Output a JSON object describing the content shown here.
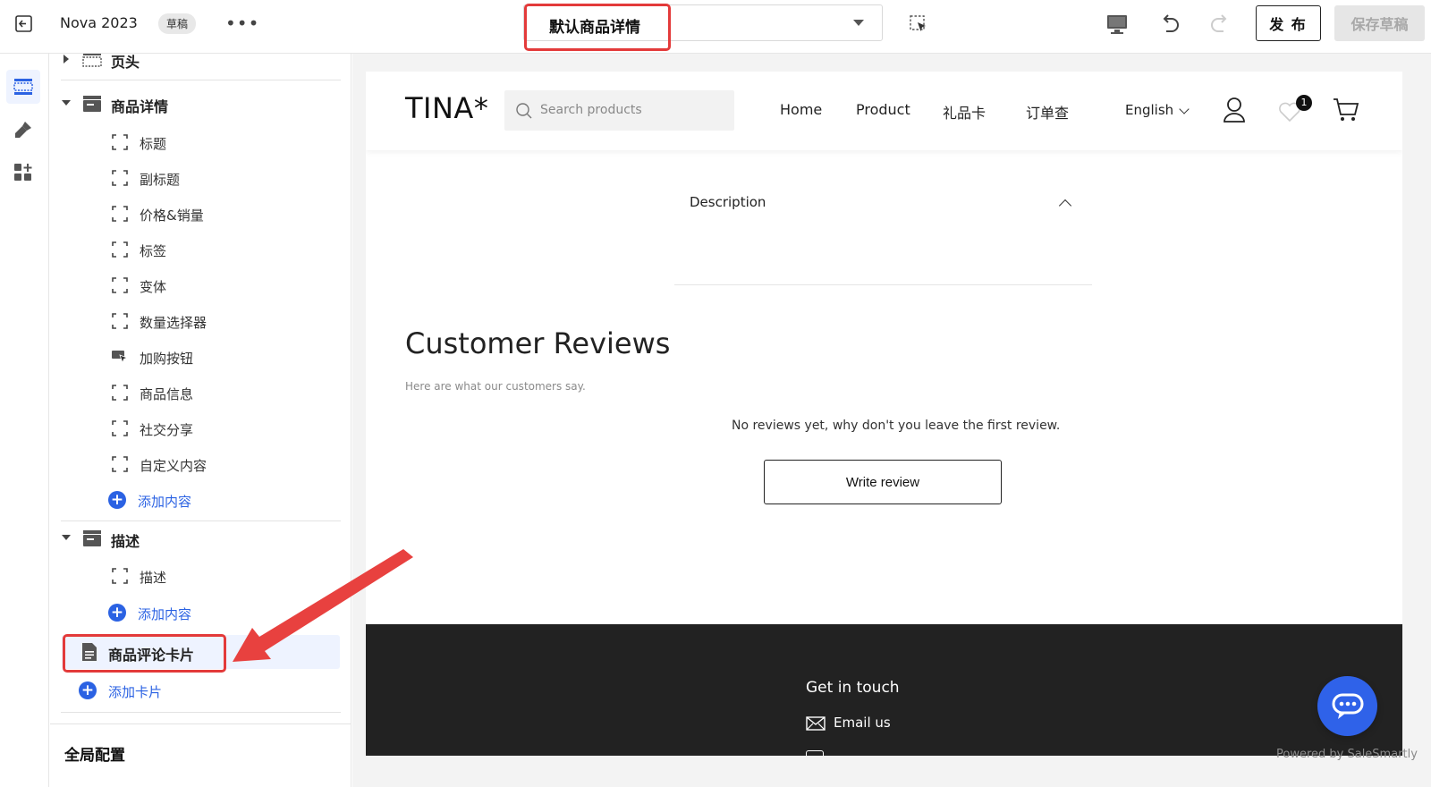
{
  "topbar": {
    "app_title": "Nova 2023",
    "draft_badge": "草稿",
    "more_label": "•••",
    "template_select": "默认商品详情",
    "publish_label": "发 布",
    "save_draft_label": "保存草稿"
  },
  "rail": {
    "items": [
      {
        "icon": "layout-sections-icon",
        "active": true
      },
      {
        "icon": "theme-brush-icon",
        "active": false
      },
      {
        "icon": "apps-add-icon",
        "active": false
      }
    ]
  },
  "panel": {
    "header_group": {
      "label": "页头"
    },
    "product_detail_group": {
      "label": "商品详情",
      "items": [
        {
          "label": "标题",
          "icon": "block-bracket-icon"
        },
        {
          "label": "副标题",
          "icon": "block-bracket-icon"
        },
        {
          "label": "价格&销量",
          "icon": "block-bracket-icon"
        },
        {
          "label": "标签",
          "icon": "block-bracket-icon"
        },
        {
          "label": "变体",
          "icon": "block-bracket-icon"
        },
        {
          "label": "数量选择器",
          "icon": "block-bracket-icon"
        },
        {
          "label": "加购按钮",
          "icon": "cursor-button-icon"
        },
        {
          "label": "商品信息",
          "icon": "block-bracket-icon"
        },
        {
          "label": "社交分享",
          "icon": "block-bracket-icon"
        },
        {
          "label": "自定义内容",
          "icon": "block-bracket-icon"
        }
      ],
      "add_label": "添加内容"
    },
    "description_group": {
      "label": "描述",
      "items": [
        {
          "label": "描述",
          "icon": "block-bracket-icon"
        }
      ],
      "add_label": "添加内容"
    },
    "review_card": {
      "label": "商品评论卡片"
    },
    "add_card_label": "添加卡片",
    "global_config_label": "全局配置"
  },
  "preview": {
    "logo": "TINA*",
    "search_placeholder": "Search products",
    "nav": [
      "Home",
      "Product",
      "礼品卡",
      "订单查"
    ],
    "language": "English",
    "wishlist_count": "1",
    "description_title": "Description",
    "reviews_title": "Customer Reviews",
    "reviews_subtitle": "Here are what our customers say.",
    "no_reviews_text": "No reviews yet, why don't you leave the first review.",
    "write_review_label": "Write review",
    "footer": {
      "title": "Get in touch",
      "email_label": "Email us"
    }
  },
  "chat": {
    "powered_by": "Powered by SaleSmartly"
  },
  "colors": {
    "accent": "#2b62e3",
    "highlight": "#e33a3a",
    "footer_bg": "#222222",
    "chat_bg": "#2f62e9"
  }
}
